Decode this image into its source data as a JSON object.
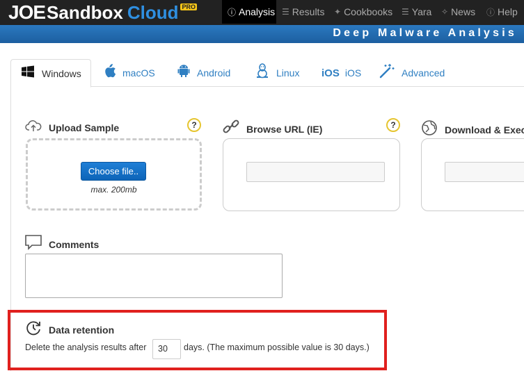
{
  "header": {
    "logo_joe": "JOE",
    "logo_sandbox": "Sandbox",
    "logo_cloud": "Cloud",
    "logo_pro": "PRO",
    "nav": [
      {
        "label": "Analysis",
        "icon": "info-circle-icon"
      },
      {
        "label": "Results",
        "icon": "list-icon"
      },
      {
        "label": "Cookbooks",
        "icon": "wand-icon"
      },
      {
        "label": "Yara",
        "icon": "list-icon"
      },
      {
        "label": "News",
        "icon": "news-icon"
      },
      {
        "label": "Help",
        "icon": "help-circle-icon"
      }
    ],
    "banner": "Deep Malware Analysis"
  },
  "tabs": [
    {
      "label": "Windows",
      "icon": "windows-icon"
    },
    {
      "label": "macOS",
      "icon": "apple-icon"
    },
    {
      "label": "Android",
      "icon": "android-icon"
    },
    {
      "label": "Linux",
      "icon": "linux-icon"
    },
    {
      "label": "iOS",
      "icon": "ios-icon",
      "prefix": "iOS"
    },
    {
      "label": "Advanced",
      "icon": "magic-wand-icon"
    }
  ],
  "upload": {
    "title": "Upload Sample",
    "button": "Choose file..",
    "hint": "max. 200mb",
    "help": "?"
  },
  "browse_url": {
    "title": "Browse URL (IE)",
    "value": "",
    "help": "?"
  },
  "download": {
    "title": "Download & Exec",
    "value": ""
  },
  "comments": {
    "title": "Comments",
    "value": ""
  },
  "retention": {
    "title": "Data retention",
    "text_before": "Delete the analysis results after",
    "days": "30",
    "text_after": "days. (The maximum possible value is 30 days.)",
    "highlight_color": "#e0201e"
  }
}
